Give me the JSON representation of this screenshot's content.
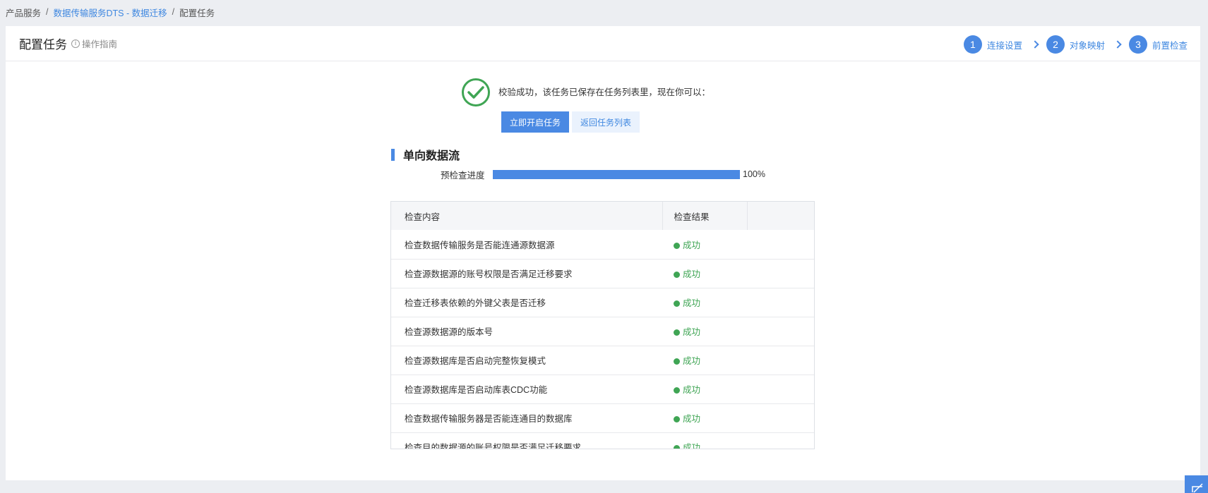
{
  "breadcrumb": {
    "root": "产品服务",
    "parent": "数据传输服务DTS - 数据迁移",
    "current": "配置任务",
    "separator": "/"
  },
  "header": {
    "title": "配置任务",
    "guide": "操作指南"
  },
  "steps": [
    {
      "num": "1",
      "label": "连接设置"
    },
    {
      "num": "2",
      "label": "对象映射"
    },
    {
      "num": "3",
      "label": "前置检查"
    }
  ],
  "result": {
    "message": "校验成功，该任务已保存在任务列表里，现在你可以：",
    "start_button": "立即开启任务",
    "back_button": "返回任务列表"
  },
  "section": {
    "title": "单向数据流",
    "progress_label": "预检查进度",
    "progress_value": 100,
    "progress_text": "100%"
  },
  "table": {
    "columns": [
      "检查内容",
      "检查结果"
    ],
    "rows": [
      {
        "item": "检查数据传输服务是否能连通源数据源",
        "status": "成功"
      },
      {
        "item": "检查源数据源的账号权限是否满足迁移要求",
        "status": "成功"
      },
      {
        "item": "检查迁移表依赖的外键父表是否迁移",
        "status": "成功"
      },
      {
        "item": "检查源数据源的版本号",
        "status": "成功"
      },
      {
        "item": "检查源数据库是否启动完整恢复模式",
        "status": "成功"
      },
      {
        "item": "检查源数据库是否启动库表CDC功能",
        "status": "成功"
      },
      {
        "item": "检查数据传输服务器是否能连通目的数据库",
        "status": "成功"
      },
      {
        "item": "检查目的数据源的账号权限是否满足迁移要求",
        "status": "成功"
      }
    ]
  },
  "colors": {
    "accent": "#4a89e3",
    "success": "#3fa554",
    "link": "#3e87e0"
  }
}
